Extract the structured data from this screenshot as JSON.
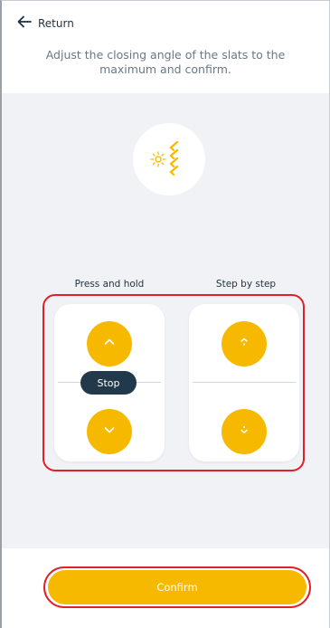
{
  "header": {
    "return_label": "Return",
    "instruction": "Adjust the closing angle of the slats to the maximum and confirm."
  },
  "icon": {
    "name": "sun-slats-icon",
    "accent": "#f7b900"
  },
  "controls": {
    "press_and_hold": {
      "label": "Press and hold",
      "stop_label": "Stop",
      "up_icon": "chevron-up-icon",
      "down_icon": "chevron-down-icon"
    },
    "step_by_step": {
      "label": "Step by step",
      "up_icon": "step-up-icon",
      "down_icon": "step-down-icon"
    }
  },
  "footer": {
    "confirm_label": "Confirm"
  },
  "colors": {
    "accent": "#f7b900",
    "dark": "#22394b",
    "background": "#f1f2f6",
    "highlight": "#e0202a"
  }
}
